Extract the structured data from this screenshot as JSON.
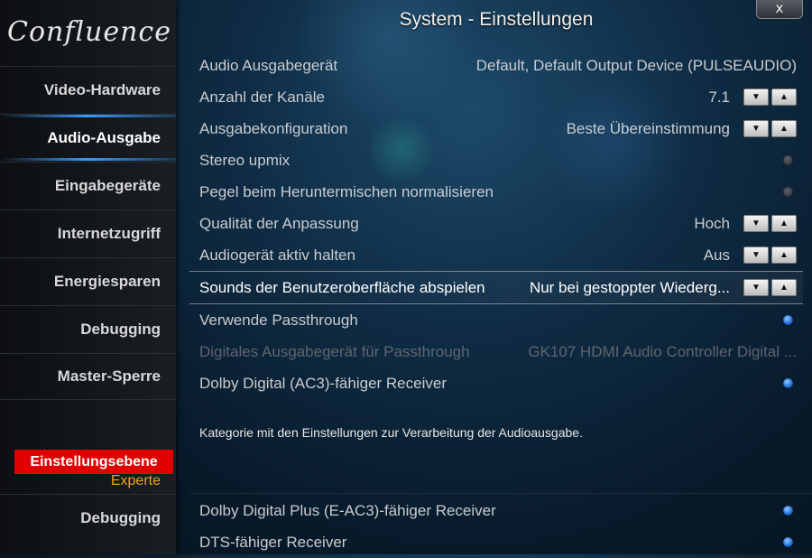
{
  "app": {
    "logo": "Confluence",
    "title": "System - Einstellungen",
    "close_label": "x"
  },
  "sidebar": {
    "items": [
      {
        "label": "Video-Hardware"
      },
      {
        "label": "Audio-Ausgabe"
      },
      {
        "label": "Eingabegeräte"
      },
      {
        "label": "Internetzugriff"
      },
      {
        "label": "Energiesparen"
      },
      {
        "label": "Debugging"
      },
      {
        "label": "Master-Sperre"
      }
    ],
    "active_index": 1,
    "level_label": "Einstellungsebene",
    "level_value": "Experte",
    "bottom_item": "Debugging"
  },
  "settings": [
    {
      "label": "Audio Ausgabegerät",
      "value": "Default, Default Output Device (PULSEAUDIO)",
      "control": "none"
    },
    {
      "label": "Anzahl der Kanäle",
      "value": "7.1",
      "control": "spin"
    },
    {
      "label": "Ausgabekonfiguration",
      "value": "Beste Übereinstimmung",
      "control": "spin"
    },
    {
      "label": "Stereo upmix",
      "value": "",
      "control": "radio",
      "on": false
    },
    {
      "label": "Pegel beim Heruntermischen normalisieren",
      "value": "",
      "control": "radio",
      "on": false
    },
    {
      "label": "Qualität der Anpassung",
      "value": "Hoch",
      "control": "spin"
    },
    {
      "label": "Audiogerät aktiv halten",
      "value": "Aus",
      "control": "spin"
    },
    {
      "label": "Sounds der Benutzeroberfläche abspielen",
      "value": "Nur bei gestoppter Wiederg...",
      "control": "spin"
    },
    {
      "label": "Verwende Passthrough",
      "value": "",
      "control": "radio",
      "on": true
    },
    {
      "label": "Digitales Ausgabegerät für Passthrough",
      "value": "GK107 HDMI Audio Controller Digital ...",
      "control": "none"
    },
    {
      "label": "Dolby Digital (AC3)-fähiger Receiver",
      "value": "",
      "control": "radio",
      "on": true
    }
  ],
  "description": "Kategorie mit den Einstellungen zur Verarbeitung der Audioausgabe.",
  "lower_settings": [
    {
      "label": "Dolby Digital Plus (E-AC3)-fähiger Receiver",
      "on": true
    },
    {
      "label": "DTS-fähiger Receiver",
      "on": true
    }
  ],
  "colors": {
    "active_accent": "#3a9aff",
    "level_bg": "#e00000",
    "level_value": "#f0a020",
    "radio_on": "#1c6cd6"
  },
  "icons": {
    "spin_down": "▼",
    "spin_up": "▲"
  }
}
